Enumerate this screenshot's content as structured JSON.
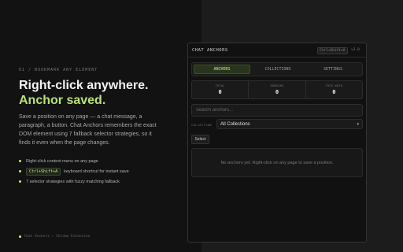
{
  "intro": {
    "eyebrow": "01 / BOOKMARK ANY ELEMENT",
    "headline_line1": "Right-click anywhere.",
    "headline_line2": "Anchor saved.",
    "description": "Save a position on any page — a chat message, a paragraph, a button. Chat Anchors remembers the exact DOM element using 7 fallback selector strategies, so it finds it even when the page changes.",
    "bullets": {
      "b1": "Right-click context menu on any page",
      "b2_kbd": "Ctrl+Shift+A",
      "b2_text": "keyboard shortcut for instant save",
      "b3": "7 selector strategies with fuzzy matching fallback"
    },
    "footer": "Chat Anchors — Chrome Extension"
  },
  "popup": {
    "title": "CHAT ANCHORS",
    "shortcut": "Ctrl+Shift+A",
    "version": "v3.0",
    "tabs": {
      "anchors": "ANCHORS",
      "collections": "COLLECTIONS",
      "settings": "SETTINGS",
      "active": "anchors"
    },
    "stats": {
      "total_label": "TOTAL",
      "total_value": "0",
      "domains_label": "DOMAINS",
      "domains_value": "0",
      "this_week_label": "THIS WEEK",
      "this_week_value": "0"
    },
    "search_placeholder": "Search anchors...",
    "collection_label": "COLLECTION",
    "collection_selected": "All Collections",
    "select_button": "Select",
    "empty_message": "No anchors yet. Right-click on any page to save a position."
  },
  "colors": {
    "accent": "#c0e87e",
    "background": "#121212",
    "panel": "#1a1a1a"
  },
  "icons": {
    "collection_dropdown": "chevron-down-icon"
  }
}
